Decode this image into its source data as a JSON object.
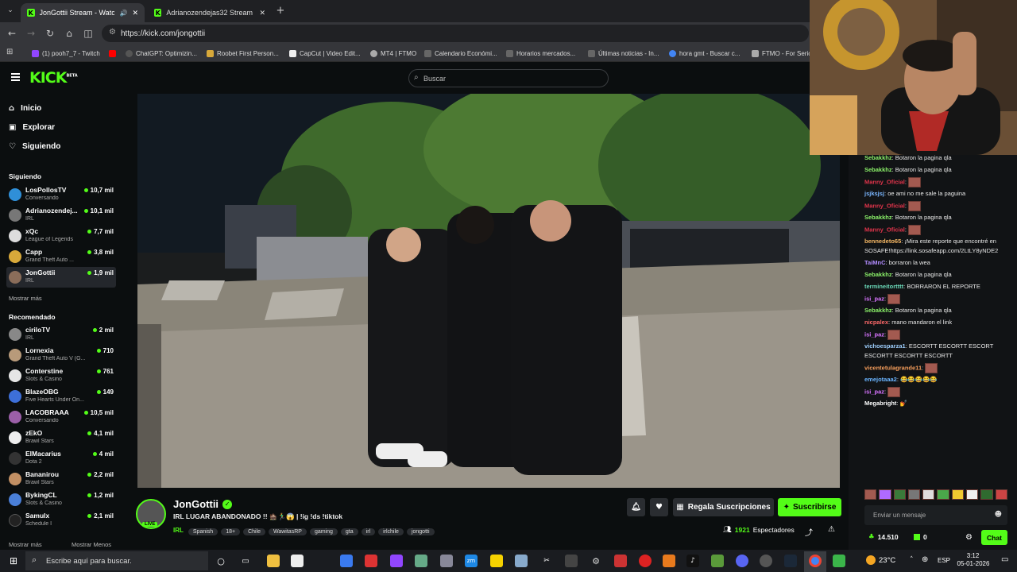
{
  "browser": {
    "tabs": [
      {
        "title": "JonGottii Stream - Watch L"
      },
      {
        "title": "Adrianozendejas32 Stream - W"
      }
    ],
    "new_tab": "+",
    "url": "https://kick.com/jongottii",
    "bookmarks": [
      "(1) pooh7_7 - Twitch",
      "ChatGPT: Optimizin...",
      "Roobet First Person...",
      "CapCut | Video Edit...",
      "MT4 | FTMO",
      "Calendario Económi...",
      "Horarios mercados...",
      "Últimas noticias - In...",
      "hora gmt - Buscar c...",
      "FTMO - For Serio"
    ]
  },
  "kick": {
    "logo": "KICK",
    "logo_beta": "BETA",
    "search_placeholder": "Buscar",
    "nav": [
      {
        "label": "Inicio",
        "icon": "home-icon"
      },
      {
        "label": "Explorar",
        "icon": "explore-icon"
      },
      {
        "label": "Siguiendo",
        "icon": "heart-icon"
      }
    ],
    "following_title": "Siguiendo",
    "following": [
      {
        "name": "LosPollosTV",
        "game": "Conversando",
        "viewers": "10,7 mil"
      },
      {
        "name": "Adrianozendej...",
        "game": "IRL",
        "viewers": "10,1 mil"
      },
      {
        "name": "xQc",
        "game": "League of Legends",
        "viewers": "7,7 mil"
      },
      {
        "name": "Capp",
        "game": "Grand Theft Auto ...",
        "viewers": "3,8 mil"
      },
      {
        "name": "JonGottii",
        "game": "IRL",
        "viewers": "1,9 mil"
      }
    ],
    "show_more": "Mostrar más",
    "recommended_title": "Recomendado",
    "recommended": [
      {
        "name": "ciriloTV",
        "game": "IRL",
        "viewers": "2 mil"
      },
      {
        "name": "Lornexia",
        "game": "Grand Theft Auto V (G...",
        "viewers": "710"
      },
      {
        "name": "Conterstine",
        "game": "Slots & Casino",
        "viewers": "761"
      },
      {
        "name": "BlazeOBG",
        "game": "Five Hearts Under On...",
        "viewers": "149"
      },
      {
        "name": "LACOBRAAA",
        "game": "Conversando",
        "viewers": "10,5 mil"
      },
      {
        "name": "zEkO",
        "game": "Brawl Stars",
        "viewers": "4,1 mil"
      },
      {
        "name": "ElMacarius",
        "game": "Dota 2",
        "viewers": "4 mil"
      },
      {
        "name": "Bananirou",
        "game": "Brawl Stars",
        "viewers": "2,2 mil"
      },
      {
        "name": "BykingCL",
        "game": "Slots & Casino",
        "viewers": "1,2 mil"
      },
      {
        "name": "Samulx",
        "game": "Schedule I",
        "viewers": "2,1 mil"
      }
    ],
    "show_more_2": "Mostrar más",
    "show_less": "Mostrar Menos"
  },
  "stream": {
    "channel": "JonGottii",
    "live_badge": "LIVE",
    "title": "IRL LUGAR ABANDONADO !! 🏚️🏃‍♂️😱 | !ig !ds !tiktok",
    "category": "IRL",
    "tags": [
      "Spanish",
      "18+",
      "Chile",
      "WawitasRP",
      "gaming",
      "gta",
      "irl",
      "irlchile",
      "jongotti"
    ],
    "gift_label": "Regala Suscripciones",
    "subscribe_label": "Suscribirse",
    "viewers": "1921",
    "viewers_label": "Espectadores"
  },
  "chat": {
    "messages": [
      {
        "user": "Sebakkhz",
        "color": "#8cf26a",
        "text": "Botaron la pagina qla"
      },
      {
        "user": "Sebakkhz",
        "color": "#8cf26a",
        "text": "Botaron la pagina qla"
      },
      {
        "user": "Manny_Oficial",
        "color": "#e0344b",
        "text": "",
        "emote": true
      },
      {
        "user": "jsjksjsj",
        "color": "#7ab6ff",
        "text": "oe ami no me sale la paguina"
      },
      {
        "user": "Manny_Oficial",
        "color": "#e0344b",
        "text": "",
        "emote": true
      },
      {
        "user": "Sebakkhz",
        "color": "#8cf26a",
        "text": "Botaron la pagina qla"
      },
      {
        "user": "Manny_Oficial",
        "color": "#e0344b",
        "text": "",
        "emote": true
      },
      {
        "user": "bennedeto65",
        "color": "#f5b764",
        "text": "¡Mira este reporte que encontré en SOSAFE!https://link.sosafeapp.com/2LtLY8yNDE2"
      },
      {
        "user": "TaiMnC",
        "color": "#b28cff",
        "text": "borraron la wea"
      },
      {
        "user": "Sebakkhz",
        "color": "#8cf26a",
        "text": "Botaron la pagina qla"
      },
      {
        "user": "termineitortttt",
        "color": "#6ad8b8",
        "text": "BORRARON EL REPORTE"
      },
      {
        "user": "isi_paz",
        "color": "#d874ff",
        "text": "",
        "emote": true
      },
      {
        "user": "Sebakkhz",
        "color": "#8cf26a",
        "text": "Botaron la pagina qla"
      },
      {
        "user": "nicpalex",
        "color": "#ff6a6a",
        "text": "mano mandaron el link"
      },
      {
        "user": "isi_paz",
        "color": "#d874ff",
        "text": "",
        "emote": true
      },
      {
        "user": "vichoesparza1",
        "color": "#9fd0ff",
        "text": "ESCORTT ESCORTT ESCORT ESCORTT ESCORTT ESCORTT"
      },
      {
        "user": "vicentetulagrande11",
        "color": "#f59d5b",
        "text": "",
        "emote": true
      },
      {
        "user": "emejotaaa2",
        "color": "#6ab4ff",
        "text": "😂😂😂😂😂"
      },
      {
        "user": "isi_paz",
        "color": "#d874ff",
        "text": "",
        "emote": true
      },
      {
        "user": "Megabright",
        "color": "#ffffff",
        "text": "💅"
      }
    ],
    "input_placeholder": "Enviar un mensaje",
    "points": "14.510",
    "tokens": "0",
    "chat_button": "Chat"
  },
  "taskbar": {
    "search_placeholder": "Escribe aquí para buscar.",
    "weather": "23°C",
    "language": "ESP",
    "time": "3:12",
    "date": "05-01-2026"
  }
}
